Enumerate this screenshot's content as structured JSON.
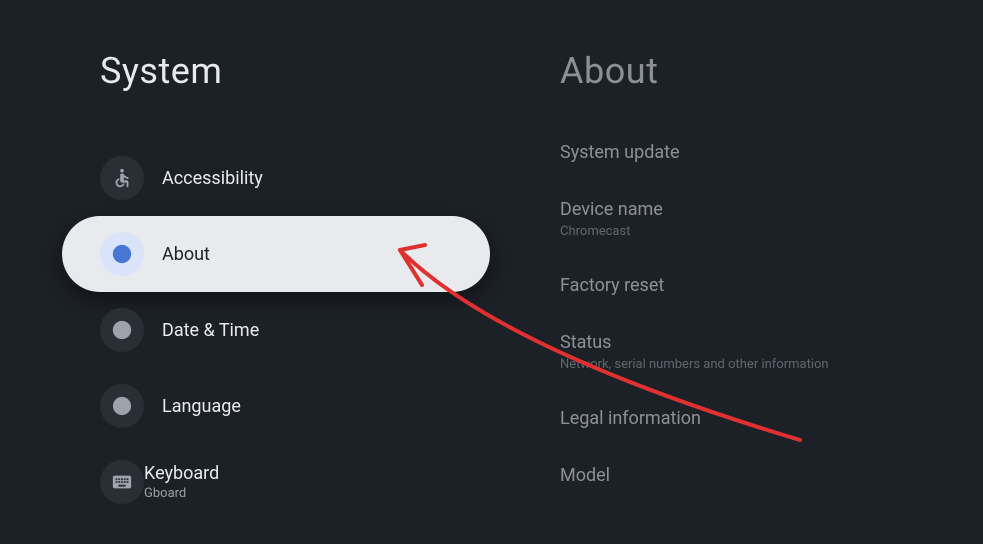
{
  "left": {
    "title": "System",
    "items": [
      {
        "id": "accessibility",
        "label": "Accessibility",
        "icon": "accessibility-icon",
        "selected": false
      },
      {
        "id": "about",
        "label": "About",
        "icon": "info-icon",
        "selected": true
      },
      {
        "id": "datetime",
        "label": "Date & Time",
        "icon": "clock-icon",
        "selected": false
      },
      {
        "id": "language",
        "label": "Language",
        "icon": "globe-icon",
        "selected": false
      },
      {
        "id": "keyboard",
        "label": "Keyboard",
        "sublabel": "Gboard",
        "icon": "keyboard-icon",
        "selected": false
      }
    ]
  },
  "right": {
    "title": "About",
    "items": [
      {
        "id": "system-update",
        "label": "System update"
      },
      {
        "id": "device-name",
        "label": "Device name",
        "sublabel": "Chromecast"
      },
      {
        "id": "factory-reset",
        "label": "Factory reset"
      },
      {
        "id": "status",
        "label": "Status",
        "sublabel": "Network, serial numbers and other information"
      },
      {
        "id": "legal",
        "label": "Legal information"
      },
      {
        "id": "model",
        "label": "Model"
      }
    ]
  }
}
